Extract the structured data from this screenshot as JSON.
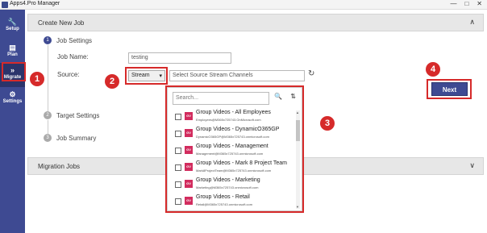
{
  "window": {
    "title": "Apps4.Pro Manager",
    "controls": [
      "—",
      "□",
      "✕"
    ]
  },
  "sidebar": {
    "items": [
      {
        "label": "Setup",
        "icon": "🔧"
      },
      {
        "label": "Plan",
        "icon": "▤"
      },
      {
        "label": "Migrate",
        "icon": "»"
      },
      {
        "label": "Settings",
        "icon": "⚙"
      }
    ]
  },
  "create_job": {
    "header": "Create New Job",
    "chevron": "∧",
    "steps": [
      {
        "num": "1",
        "label": "Job Settings"
      },
      {
        "num": "2",
        "label": "Target Settings"
      },
      {
        "num": "3",
        "label": "Job Summary"
      }
    ],
    "job_name_label": "Job Name:",
    "job_name_value": "testing",
    "source_label": "Source:",
    "source_type": "Stream",
    "source_type_arrow": "▾",
    "source_placeholder": "Select Source Stream Channels",
    "refresh_icon": "↻",
    "next_label": "Next"
  },
  "dropdown": {
    "search_placeholder": "Search...",
    "search_icon": "🔍",
    "sort_icon": "⇅",
    "badge": "GV",
    "items": [
      {
        "name": "Group Videos - All Employees",
        "email": "Employees@M365x725743.OnMicrosoft.com"
      },
      {
        "name": "Group Videos - DynamicO365GP",
        "email": "DynamicO365GP@M365x725743.onmicrosoft.com"
      },
      {
        "name": "Group Videos - Management",
        "email": "Management@M365x725743.onmicrosoft.com"
      },
      {
        "name": "Group Videos - Mark 8 Project Team",
        "email": "Mark8ProjectTeam@M365x725743.onmicrosoft.com"
      },
      {
        "name": "Group Videos - Marketing",
        "email": "Marketing@M365x725743.onmicrosoft.com"
      },
      {
        "name": "Group Videos - Retail",
        "email": "Retail@M365x725743.onmicrosoft.com"
      }
    ]
  },
  "migration_jobs": {
    "header": "Migration Jobs",
    "chevron": "∨"
  },
  "callouts": [
    "1",
    "2",
    "3",
    "4"
  ],
  "colors": {
    "sidebar": "#3e4a92",
    "accent": "#3e4a92",
    "callout": "#d62a2a",
    "badge": "#d22c5e"
  }
}
